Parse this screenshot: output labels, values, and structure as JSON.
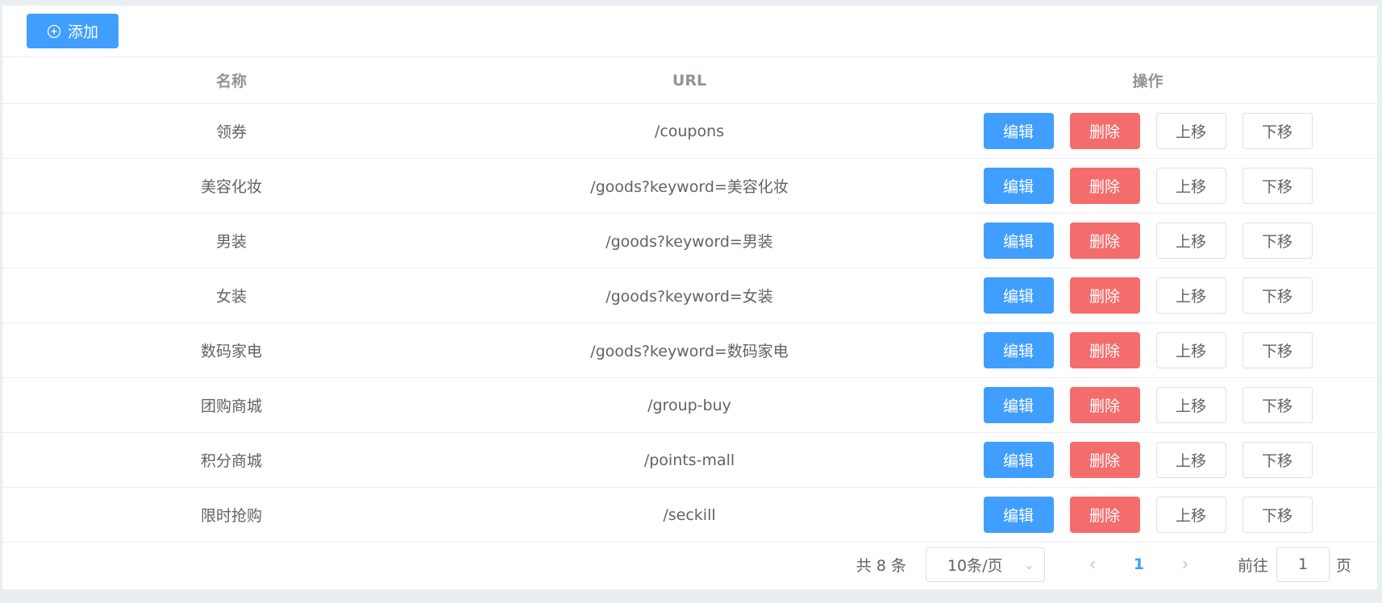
{
  "toolbar": {
    "add_label": "添加",
    "add_icon": "plus-circle-icon"
  },
  "table": {
    "headers": [
      "名称",
      "URL",
      "操作"
    ],
    "actions": {
      "edit": "编辑",
      "delete": "删除",
      "up": "上移",
      "down": "下移"
    },
    "rows": [
      {
        "name": "领券",
        "url": "/coupons"
      },
      {
        "name": "美容化妆",
        "url": "/goods?keyword=美容化妆"
      },
      {
        "name": "男装",
        "url": "/goods?keyword=男装"
      },
      {
        "name": "女装",
        "url": "/goods?keyword=女装"
      },
      {
        "name": "数码家电",
        "url": "/goods?keyword=数码家电"
      },
      {
        "name": "团购商城",
        "url": "/group-buy"
      },
      {
        "name": "积分商城",
        "url": "/points-mall"
      },
      {
        "name": "限时抢购",
        "url": "/seckill"
      }
    ]
  },
  "pagination": {
    "total_text": "共 8 条",
    "page_size": "10条/页",
    "current_page": "1",
    "goto_label": "前往",
    "goto_value": "1",
    "page_suffix": "页"
  },
  "colors": {
    "primary": "#409eff",
    "danger": "#f56c6c",
    "border": "#dcdfe6",
    "background": "#e9eef3"
  }
}
